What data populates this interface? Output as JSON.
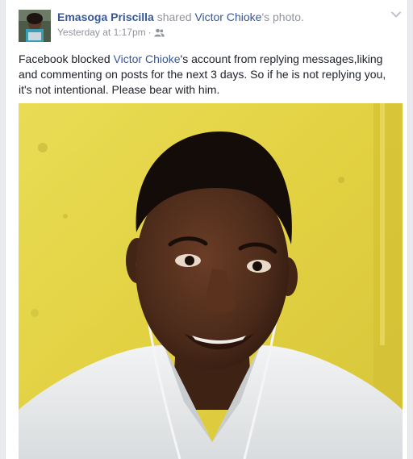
{
  "post": {
    "author": "Emasoga Priscilla",
    "action_text": " shared ",
    "shared_from": "Victor Chioke",
    "shared_suffix": "'s photo.",
    "timestamp": "Yesterday at 1:17pm",
    "separator": "·",
    "audience_icon": "friends-icon",
    "menu_icon": "chevron-down-icon",
    "body": {
      "part1": "Facebook blocked ",
      "mention": "Victor Chioke",
      "part2": "'s account from replying messages,liking and commenting on posts for the next 3 days. So if he is not replying you, it's not intentional. Please bear with him."
    }
  },
  "colors": {
    "link": "#365899",
    "meta": "#90949c",
    "text": "#1d2129",
    "photo_background": "#e4d344"
  }
}
